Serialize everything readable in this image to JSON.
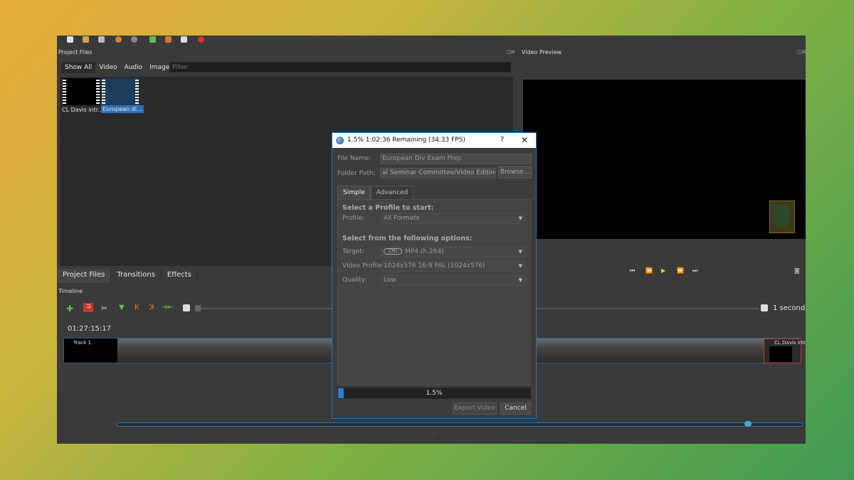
{
  "panels": {
    "project_files_title": "Project Files",
    "video_preview_title": "Video Preview",
    "dock_controls": "◫⊠"
  },
  "project_files": {
    "tabs": [
      "Show All",
      "Video",
      "Audio",
      "Image"
    ],
    "active_tab": "Show All",
    "filter_placeholder": "Filter",
    "items": [
      {
        "label": "CL Davis intr...",
        "selected": false
      },
      {
        "label": "European di...",
        "selected": true
      }
    ]
  },
  "bottom_tabs": [
    "Project Files",
    "Transitions",
    "Effects"
  ],
  "timeline": {
    "title": "Timeline",
    "timecode": "01:27:15:17",
    "zoom_label": "1 seconds",
    "track_name": "Track 1",
    "clip_name": "CL Davis intr"
  },
  "dialog": {
    "title": "1.5%  1:02:36 Remaining (34.33 FPS)",
    "help": "?",
    "close": "✕",
    "file_name_label": "File Name:",
    "file_name_value": "European Div Exam Prep",
    "folder_path_label": "Folder Path:",
    "folder_path_value": "al Seminar Committee/Video Editing",
    "browse_label": "Browse...",
    "tabs": [
      "Simple",
      "Advanced"
    ],
    "active_tab": "Simple",
    "section1_heading": "Select a Profile to start:",
    "profile_label": "Profile:",
    "profile_value": "All Formats",
    "section2_heading": "Select from the following options:",
    "target_label": "Target:",
    "target_badge": "CPU",
    "target_value": "MP4 (h.264)",
    "video_profile_label": "Video Profile:",
    "video_profile_value": "1024x576 16:9 PAL (1024x576)",
    "quality_label": "Quality:",
    "quality_value": "Low",
    "progress_text": "1.5%",
    "progress_value": 0.015,
    "export_label": "Export Video",
    "cancel_label": "Cancel"
  },
  "colors": {
    "accent": "#2f7bd2",
    "dialog_border": "#1b7ac9",
    "clip_border": "#c0392b"
  }
}
